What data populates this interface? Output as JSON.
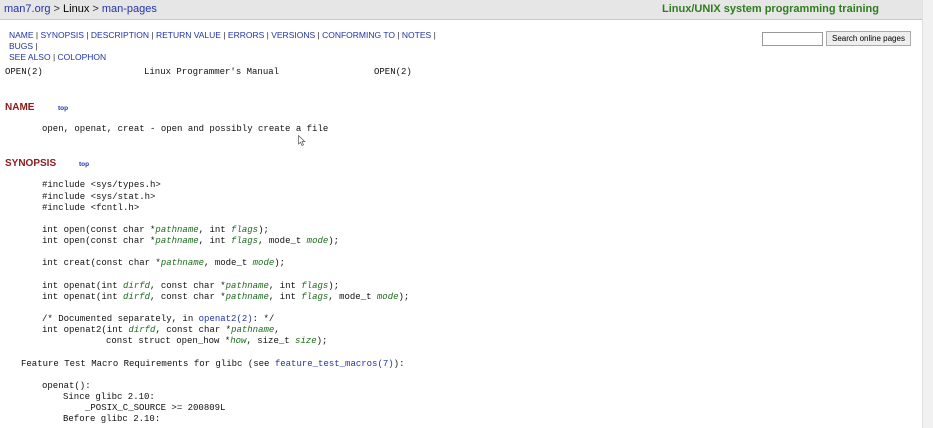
{
  "topbar": {
    "crumb_site": "man7.org",
    "crumb_sep1": " > ",
    "crumb_linux": "Linux",
    "crumb_sep2": " > ",
    "crumb_manpages": "man-pages",
    "training_link": "Linux/UNIX system programming training"
  },
  "nav": {
    "links": [
      "NAME",
      "SYNOPSIS",
      "DESCRIPTION",
      "RETURN VALUE",
      "ERRORS",
      "VERSIONS",
      "CONFORMING TO",
      "NOTES",
      "BUGS",
      "SEE ALSO",
      "COLOPHON"
    ]
  },
  "search": {
    "value": "",
    "button_label": "Search online pages"
  },
  "header": {
    "left": "OPEN(2)",
    "center": "Linux Programmer's Manual",
    "right": "OPEN(2)"
  },
  "sections": {
    "name_title": "NAME",
    "synopsis_title": "SYNOPSIS",
    "top_label": "top"
  },
  "name_text": "open, openat, creat - open and possibly create a file",
  "synopsis": {
    "inc1": "#include <sys/types.h>",
    "inc2": "#include <sys/stat.h>",
    "inc3": "#include <fcntl.h>",
    "comment_pre": "/* Documented separately, in ",
    "comment_link": "openat2(2)",
    "comment_post": ": */",
    "ftm_pre": "Feature Test Macro Requirements for glibc (see ",
    "ftm_link": "feature_test_macros(7)",
    "ftm_post": "):",
    "openat_label": "openat():",
    "since": "Since glibc 2.10:",
    "posix": "_POSIX_C_SOURCE >= 200809L",
    "before": "Before glibc 2.10:"
  }
}
